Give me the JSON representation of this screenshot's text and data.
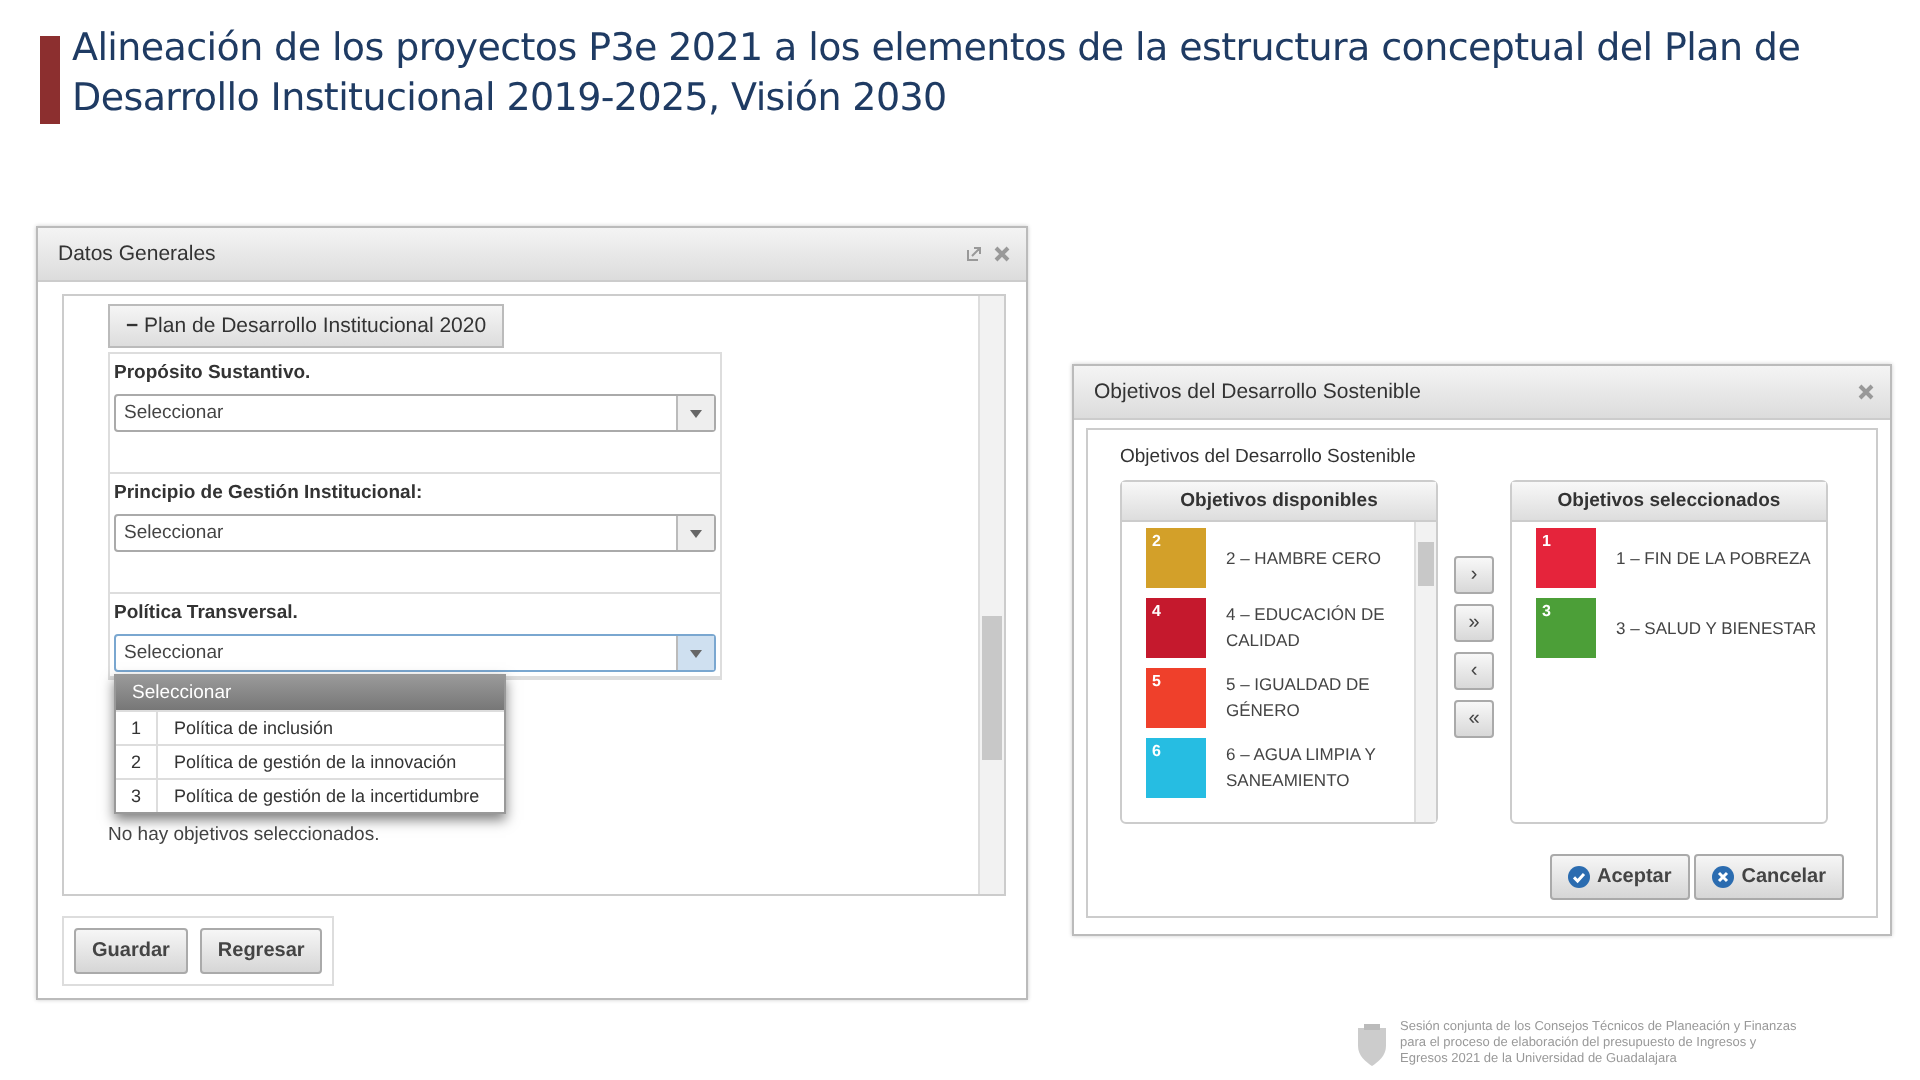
{
  "slide_title": "Alineación de los proyectos P3e 2021 a los elementos de la estructura conceptual del Plan de Desarrollo Institucional 2019-2025, Visión 2030",
  "datos_generales": {
    "title": "Datos Generales",
    "section_toggle": "−",
    "section_title": "Plan de Desarrollo Institucional 2020",
    "fields": [
      {
        "label": "Propósito Sustantivo.",
        "value": "Seleccionar",
        "open": false
      },
      {
        "label": "Principio de Gestión Institucional:",
        "value": "Seleccionar",
        "open": false
      },
      {
        "label": "Política Transversal.",
        "value": "Seleccionar",
        "open": true
      }
    ],
    "dropdown": {
      "header": "Seleccionar",
      "options": [
        {
          "num": "1",
          "text": "Política de inclusión"
        },
        {
          "num": "2",
          "text": "Política de gestión de la innovación"
        },
        {
          "num": "3",
          "text": "Política de gestión de la incertidumbre"
        }
      ]
    },
    "empty_message": "No hay objetivos seleccionados.",
    "buttons": [
      "Guardar",
      "Regresar"
    ]
  },
  "objetivos": {
    "title": "Objetivos del Desarrollo Sostenible",
    "panel_title": "Objetivos del Desarrollo Sostenible",
    "available": {
      "header": "Objetivos disponibles",
      "items": [
        {
          "num": "2",
          "text": "2 – HAMBRE CERO",
          "color": "#d3a029"
        },
        {
          "num": "4",
          "text": "4 – EDUCACIÓN DE CALIDAD",
          "color": "#c5192d"
        },
        {
          "num": "5",
          "text": "5 – IGUALDAD DE GÉNERO",
          "color": "#ef402b"
        },
        {
          "num": "6",
          "text": "6 – AGUA LIMPIA Y SANEAMIENTO",
          "color": "#26bde2"
        }
      ]
    },
    "move_buttons": [
      "›",
      "»",
      "‹",
      "«"
    ],
    "selected": {
      "header": "Objetivos seleccionados",
      "items": [
        {
          "num": "1",
          "text": "1 – FIN DE LA POBREZA",
          "color": "#e5243b"
        },
        {
          "num": "3",
          "text": "3 – SALUD Y BIENESTAR",
          "color": "#4c9f38"
        }
      ]
    },
    "buttons": [
      {
        "label": "Aceptar",
        "kind": "accept"
      },
      {
        "label": "Cancelar",
        "kind": "cancel"
      }
    ]
  },
  "footer": {
    "text": "Sesión conjunta de los Consejos Técnicos de Planeación y Finanzas para el proceso de elaboración del presupuesto de Ingresos y Egresos 2021 de la Universidad de Guadalajara"
  }
}
